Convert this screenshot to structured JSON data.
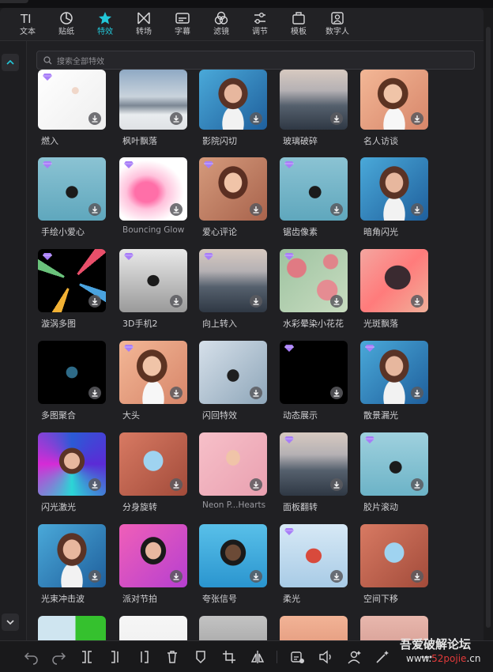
{
  "toolbar": {
    "items": [
      {
        "label": "文本",
        "icon": "text-icon"
      },
      {
        "label": "贴纸",
        "icon": "sticker-icon"
      },
      {
        "label": "特效",
        "icon": "star-effect-icon",
        "active": true
      },
      {
        "label": "转场",
        "icon": "transition-icon"
      },
      {
        "label": "字幕",
        "icon": "subtitle-icon"
      },
      {
        "label": "滤镜",
        "icon": "filter-icon"
      },
      {
        "label": "调节",
        "icon": "adjust-icon"
      },
      {
        "label": "模板",
        "icon": "template-icon"
      },
      {
        "label": "数字人",
        "icon": "digital-human-icon"
      }
    ],
    "accent_color": "#22c7d8"
  },
  "search": {
    "placeholder": "搜索全部特效"
  },
  "effects": [
    {
      "label": "燃入",
      "premium": true,
      "thumb": "white-fire"
    },
    {
      "label": "枫叶飘落",
      "premium": false,
      "thumb": "house-leaves"
    },
    {
      "label": "影院闪切",
      "premium": false,
      "thumb": "portrait-blue"
    },
    {
      "label": "玻璃破碎",
      "premium": false,
      "thumb": "city"
    },
    {
      "label": "名人访谈",
      "premium": false,
      "thumb": "portrait-peach"
    },
    {
      "label": "手绘小爱心",
      "premium": true,
      "thumb": "skater-hearts"
    },
    {
      "label": "Bouncing Glow",
      "premium": true,
      "thumb": "pink-blur"
    },
    {
      "label": "爱心评论",
      "premium": true,
      "thumb": "portrait-warm"
    },
    {
      "label": "锯齿像素",
      "premium": true,
      "thumb": "skater"
    },
    {
      "label": "暗角闪光",
      "premium": false,
      "thumb": "portrait-blue"
    },
    {
      "label": "漩涡多图",
      "premium": true,
      "thumb": "swirl-photos"
    },
    {
      "label": "3D手机2",
      "premium": true,
      "thumb": "phone-3d"
    },
    {
      "label": "向上转入",
      "premium": true,
      "thumb": "city"
    },
    {
      "label": "水彩晕染小花花",
      "premium": true,
      "thumb": "roses"
    },
    {
      "label": "光斑飘落",
      "premium": false,
      "thumb": "bokeh-silhouette"
    },
    {
      "label": "多图聚合",
      "premium": false,
      "thumb": "black-tile"
    },
    {
      "label": "大头",
      "premium": true,
      "thumb": "portrait-peach"
    },
    {
      "label": "闪回特效",
      "premium": false,
      "thumb": "fashion-flash"
    },
    {
      "label": "动态展示",
      "premium": true,
      "thumb": "black"
    },
    {
      "label": "散景漏光",
      "premium": true,
      "thumb": "portrait-blue"
    },
    {
      "label": "闪光激光",
      "premium": false,
      "thumb": "laser-portrait"
    },
    {
      "label": "分身旋转",
      "premium": false,
      "thumb": "courtyard"
    },
    {
      "label": "Neon P...Hearts",
      "premium": false,
      "thumb": "neon-hearts"
    },
    {
      "label": "面板翻转",
      "premium": true,
      "thumb": "city"
    },
    {
      "label": "胶片滚动",
      "premium": true,
      "thumb": "film-skater"
    },
    {
      "label": "光束冲击波",
      "premium": false,
      "thumb": "portrait-blue"
    },
    {
      "label": "派对节拍",
      "premium": false,
      "thumb": "party-pink"
    },
    {
      "label": "夸张信号",
      "premium": false,
      "thumb": "man-blue"
    },
    {
      "label": "柔光",
      "premium": true,
      "thumb": "boy-jump"
    },
    {
      "label": "空间下移",
      "premium": false,
      "thumb": "courtyard"
    },
    {
      "label": "",
      "premium": false,
      "thumb": "partial-skater-green"
    },
    {
      "label": "",
      "premium": false,
      "thumb": "partial-white"
    },
    {
      "label": "",
      "premium": false,
      "thumb": "partial-gray"
    },
    {
      "label": "",
      "premium": false,
      "thumb": "partial-portrait"
    },
    {
      "label": "",
      "premium": false,
      "thumb": "partial-pink"
    }
  ],
  "bottom_toolbar": {
    "icons": [
      "undo-icon",
      "redo-icon",
      "split-icon",
      "split-left-icon",
      "split-right-icon",
      "delete-icon",
      "marker-icon",
      "crop-icon",
      "mirror-icon",
      "speed-icon",
      "audio-icon",
      "person-effect-icon",
      "magic-icon",
      "more-icon"
    ]
  },
  "watermark": {
    "line1": "吾爱破解论坛",
    "line2_a": "www.",
    "line2_b": "52pojie",
    "line2_c": ".cn"
  }
}
